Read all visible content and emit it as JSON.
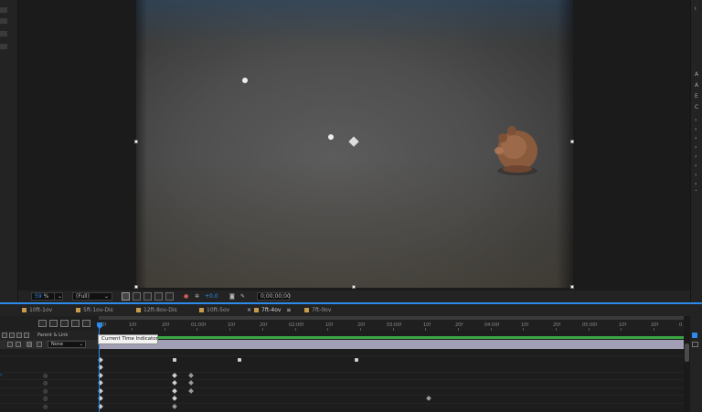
{
  "viewer": {
    "zoom": "59",
    "zoom_unit": "%",
    "resolution": "(Full)",
    "exposure": "+0.0",
    "timecode": "0;00;00;00"
  },
  "colors": {
    "accent": "#2d8ceb",
    "comp_tab_swatch": "#c99b4e",
    "layer_bar": "#a09fb6",
    "work_area": "#3aa643"
  },
  "comp_tabs": [
    {
      "label": "10ft-1ov"
    },
    {
      "label": "5ft-1ov-Dis"
    },
    {
      "label": "12ft-8ov-Dis"
    },
    {
      "label": "10ft-5ov"
    },
    {
      "label": "7ft-4ov"
    },
    {
      "label": "7ft-0ov"
    }
  ],
  "timeline": {
    "ticks": [
      "00f",
      "10f",
      "20f",
      "01:00f",
      "10f",
      "20f",
      "02:00f",
      "10f",
      "20f",
      "03:00f",
      "10f",
      "20f",
      "04:00f",
      "10f",
      "20f",
      "05:00f",
      "10f",
      "20f",
      "0"
    ],
    "tooltip": "Current Time Indicator",
    "header_label": "Parent & Link",
    "parent_value": "None"
  },
  "icons": {
    "pig": "pig-figurine",
    "swatch": "label-color"
  }
}
